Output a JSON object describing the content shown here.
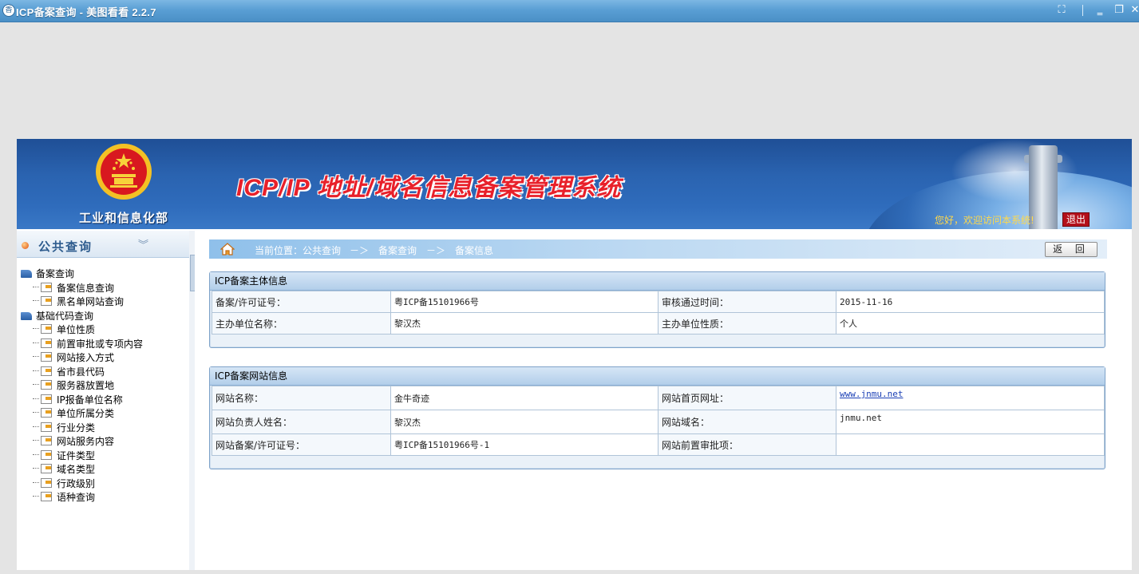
{
  "window": {
    "app_icon_glyph": "香",
    "title": "ICP备案查询 - 美图看看 2.2.7",
    "buttons": {
      "fullscreen": "⛶",
      "minimize": "‗",
      "restore": "❐",
      "close": "✕"
    }
  },
  "banner": {
    "ministry": "工业和信息化部",
    "system_title": "ICP/IP 地址/域名信息备案管理系统",
    "welcome": "您好，欢迎访问本系统!",
    "logout": "退出"
  },
  "sidebar": {
    "title": "公共查询",
    "collapse_glyph": "︾",
    "groups": [
      {
        "label": "备案查询",
        "items": [
          "备案信息查询",
          "黑名单网站查询"
        ]
      },
      {
        "label": "基础代码查询",
        "items": [
          "单位性质",
          "前置审批或专项内容",
          "网站接入方式",
          "省市县代码",
          "服务器放置地",
          "IP报备单位名称",
          "单位所属分类",
          "行业分类",
          "网站服务内容",
          "证件类型",
          "域名类型",
          "行政级别",
          "语种查询"
        ]
      }
    ]
  },
  "breadcrumb": {
    "label": "当前位置：公共查询",
    "separator": "－＞",
    "segments": [
      "备案查询",
      "备案信息"
    ]
  },
  "back_button": "返 回",
  "subject_panel": {
    "title": "ICP备案主体信息",
    "rows": [
      {
        "label1": "备案/许可证号：",
        "value1": "粤ICP备15101966号",
        "label2": "审核通过时间：",
        "value2": "2015-11-16"
      },
      {
        "label1": "主办单位名称：",
        "value1": "黎汉杰",
        "label2": "主办单位性质：",
        "value2": "个人"
      }
    ]
  },
  "website_panel": {
    "title": "ICP备案网站信息",
    "rows": [
      {
        "label1": "网站名称：",
        "value1": "金牛奇迹",
        "label2": "网站首页网址：",
        "value2": "www.jnmu.net"
      },
      {
        "label1": "网站负责人姓名：",
        "value1": "黎汉杰",
        "label2": "网站域名：",
        "value2": "jnmu.net"
      },
      {
        "label1": "网站备案/许可证号：",
        "value1": "粤ICP备15101966号-1",
        "label2": "网站前置审批项：",
        "value2": ""
      }
    ]
  },
  "colors": {
    "banner_blue": "#2a63b0",
    "title_red": "#e8202a",
    "welcome_yellow": "#ffd84a",
    "logout_red": "#b3101b"
  }
}
